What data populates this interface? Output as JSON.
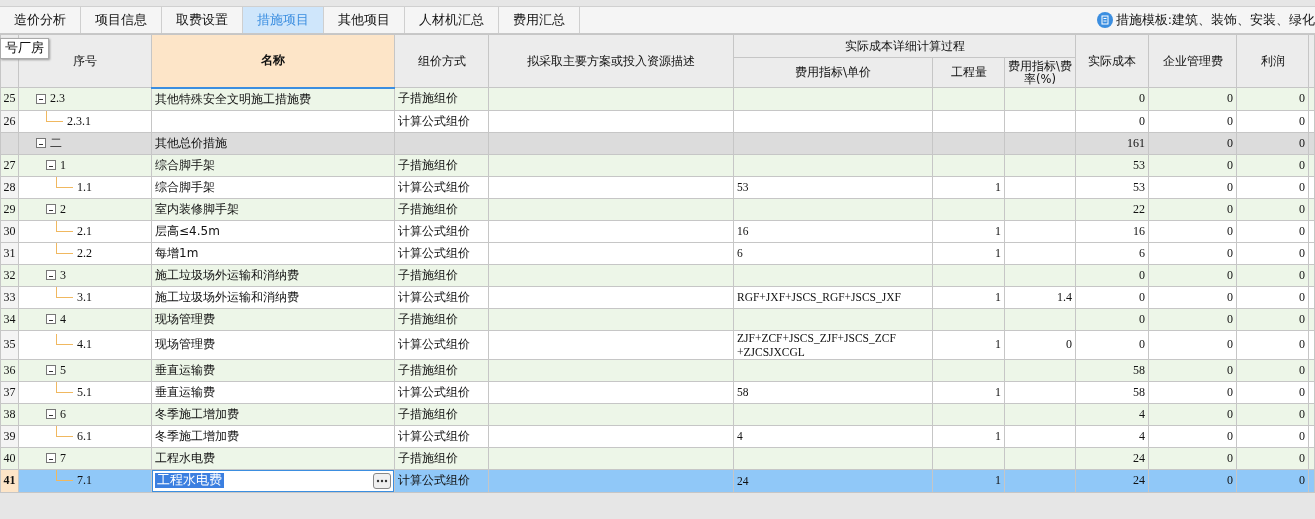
{
  "tabs": [
    {
      "label": "造价分析",
      "selected": false
    },
    {
      "label": "项目信息",
      "selected": false
    },
    {
      "label": "取费设置",
      "selected": false
    },
    {
      "label": "措施项目",
      "selected": true
    },
    {
      "label": "其他项目",
      "selected": false
    },
    {
      "label": "人材机汇总",
      "selected": false
    },
    {
      "label": "费用汇总",
      "selected": false
    }
  ],
  "template_label": "措施模板:建筑、装饰、安装、绿化",
  "tooltip": "号厂房",
  "column_group": "实际成本详细计算过程",
  "columns": [
    {
      "label": "序号",
      "selected": false
    },
    {
      "label": "名称",
      "selected": true
    },
    {
      "label": "组价方式",
      "selected": false
    },
    {
      "label": "拟采取主要方案或投入资源描述",
      "selected": false
    },
    {
      "label": "费用指标\\单价",
      "selected": false
    },
    {
      "label": "工程量",
      "selected": false
    },
    {
      "label": "费用指标\\费率(%)",
      "selected": false
    },
    {
      "label": "实际成本",
      "selected": false
    },
    {
      "label": "企业管理费",
      "selected": false
    },
    {
      "label": "利润",
      "selected": false
    }
  ],
  "rows": [
    {
      "no": "25",
      "code": "2.3",
      "name": "其他特殊安全文明施工措施费",
      "method": "子措施组价",
      "kind": "group",
      "expanded": true,
      "selected": false,
      "cost": "0",
      "mgmt": "0",
      "profit": "0",
      "children": [
        {
          "no": "26",
          "code": "2.3.1",
          "method": "计算公式组价",
          "kind": "leaf",
          "selected": false,
          "cost": "0",
          "mgmt": "0",
          "profit": "0"
        }
      ]
    },
    {
      "code": "二",
      "name": "其他总价措施",
      "kind": "section",
      "expanded": true,
      "selected": false,
      "cost": "161",
      "mgmt": "0",
      "profit": "0",
      "children": [
        {
          "no": "27",
          "code": "1",
          "name": "综合脚手架",
          "method": "子措施组价",
          "kind": "group",
          "expanded": true,
          "selected": false,
          "cost": "53",
          "mgmt": "0",
          "profit": "0",
          "children": [
            {
              "no": "28",
              "code": "1.1",
              "name": "综合脚手架",
              "method": "计算公式组价",
              "kind": "leaf",
              "selected": false,
              "price": "53",
              "qty": "1",
              "cost": "53",
              "mgmt": "0",
              "profit": "0"
            }
          ]
        },
        {
          "no": "29",
          "code": "2",
          "name": "室内装修脚手架",
          "method": "子措施组价",
          "kind": "group",
          "expanded": true,
          "selected": false,
          "cost": "22",
          "mgmt": "0",
          "profit": "0",
          "children": [
            {
              "no": "30",
              "code": "2.1",
              "name": "层高≤4.5m",
              "method": "计算公式组价",
              "kind": "leaf",
              "selected": false,
              "price": "16",
              "qty": "1",
              "cost": "16",
              "mgmt": "0",
              "profit": "0"
            },
            {
              "no": "31",
              "code": "2.2",
              "name": "每增1m",
              "method": "计算公式组价",
              "kind": "leaf",
              "selected": false,
              "price": "6",
              "qty": "1",
              "cost": "6",
              "mgmt": "0",
              "profit": "0"
            }
          ]
        },
        {
          "no": "32",
          "code": "3",
          "name": "施工垃圾场外运输和消纳费",
          "method": "子措施组价",
          "kind": "group",
          "expanded": true,
          "selected": false,
          "cost": "0",
          "mgmt": "0",
          "profit": "0",
          "children": [
            {
              "no": "33",
              "code": "3.1",
              "name": "施工垃圾场外运输和消纳费",
              "method": "计算公式组价",
              "kind": "leaf",
              "selected": false,
              "price": "RGF+JXF+JSCS_RGF+JSCS_JXF",
              "qty": "1",
              "rate": "1.4",
              "cost": "0",
              "mgmt": "0",
              "profit": "0"
            }
          ]
        },
        {
          "no": "34",
          "code": "4",
          "name": "现场管理费",
          "method": "子措施组价",
          "kind": "group",
          "expanded": true,
          "selected": false,
          "cost": "0",
          "mgmt": "0",
          "profit": "0",
          "children": [
            {
              "no": "35",
              "code": "4.1",
              "name": "现场管理费",
              "method": "计算公式组价",
              "kind": "leaf",
              "selected": false,
              "price": "ZJF+ZCF+JSCS_ZJF+JSCS_ZCF\n+ZJCSJXCGL",
              "qty": "1",
              "rate": "0",
              "cost": "0",
              "mgmt": "0",
              "profit": "0"
            }
          ]
        },
        {
          "no": "36",
          "code": "5",
          "name": "垂直运输费",
          "method": "子措施组价",
          "kind": "group",
          "expanded": true,
          "selected": false,
          "cost": "58",
          "mgmt": "0",
          "profit": "0",
          "children": [
            {
              "no": "37",
              "code": "5.1",
              "name": "垂直运输费",
              "method": "计算公式组价",
              "kind": "leaf",
              "selected": false,
              "price": "58",
              "qty": "1",
              "cost": "58",
              "mgmt": "0",
              "profit": "0"
            }
          ]
        },
        {
          "no": "38",
          "code": "6",
          "name": "冬季施工增加费",
          "method": "子措施组价",
          "kind": "group",
          "expanded": true,
          "selected": false,
          "cost": "4",
          "mgmt": "0",
          "profit": "0",
          "children": [
            {
              "no": "39",
              "code": "6.1",
              "name": "冬季施工增加费",
              "method": "计算公式组价",
              "kind": "leaf",
              "selected": false,
              "price": "4",
              "qty": "1",
              "cost": "4",
              "mgmt": "0",
              "profit": "0"
            }
          ]
        },
        {
          "no": "40",
          "code": "7",
          "name": "工程水电费",
          "method": "子措施组价",
          "kind": "group",
          "expanded": true,
          "selected": false,
          "cost": "24",
          "mgmt": "0",
          "profit": "0",
          "children": [
            {
              "no": "41",
              "code": "7.1",
              "name": "工程水电费",
              "method": "计算公式组价",
              "kind": "leaf",
              "selected": true,
              "price": "24",
              "qty": "1",
              "cost": "24",
              "mgmt": "0",
              "profit": "0"
            }
          ]
        }
      ]
    }
  ]
}
